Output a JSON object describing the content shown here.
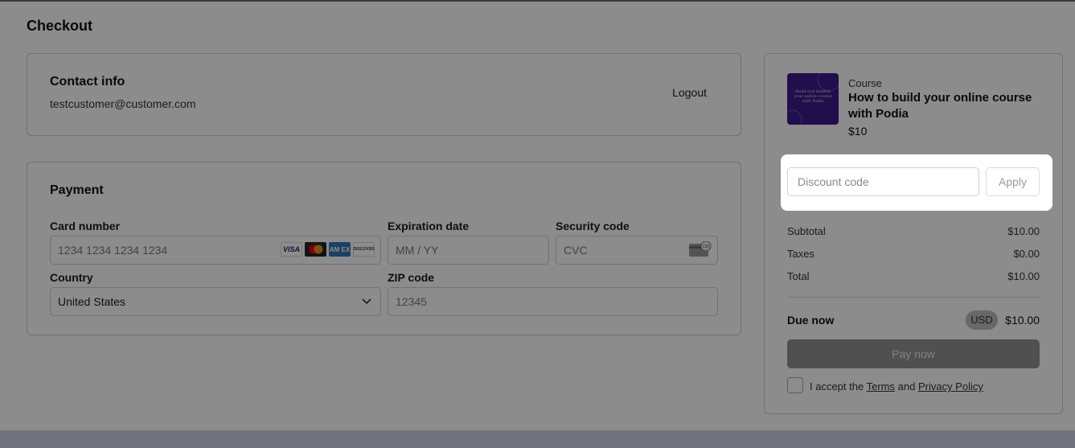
{
  "page": {
    "title": "Checkout"
  },
  "contact": {
    "title": "Contact info",
    "email": "testcustomer@customer.com",
    "logout_label": "Logout"
  },
  "payment": {
    "title": "Payment",
    "card_number": {
      "label": "Card number",
      "placeholder": "1234 1234 1234 1234"
    },
    "expiration": {
      "label": "Expiration date",
      "placeholder": "MM / YY"
    },
    "security": {
      "label": "Security code",
      "placeholder": "CVC"
    },
    "country": {
      "label": "Country",
      "value": "United States"
    },
    "zip": {
      "label": "ZIP code",
      "placeholder": "12345"
    },
    "brands": {
      "visa": "VISA",
      "amex": "AM EX",
      "discover": "DISCOVER"
    }
  },
  "summary": {
    "course_type": "Course",
    "course_title": "How to build your online course with Podia",
    "course_price": "$10",
    "thumb_text": "Build and market your online course with Podia",
    "discount": {
      "placeholder": "Discount code",
      "apply_label": "Apply"
    },
    "lines": [
      {
        "label": "Subtotal",
        "value": "$10.00"
      },
      {
        "label": "Taxes",
        "value": "$0.00"
      },
      {
        "label": "Total",
        "value": "$10.00"
      }
    ],
    "due_label": "Due now",
    "currency": "USD",
    "due_value": "$10.00",
    "pay_label": "Pay now",
    "accept": {
      "prefix": "I accept the",
      "terms": "Terms",
      "and": "and",
      "privacy": "Privacy Policy"
    }
  },
  "colors": {
    "overlay": "#000000",
    "course_thumb": "#3d1a8a",
    "amex": "#2e77bb",
    "footer_strip": "#d0cfe2"
  }
}
